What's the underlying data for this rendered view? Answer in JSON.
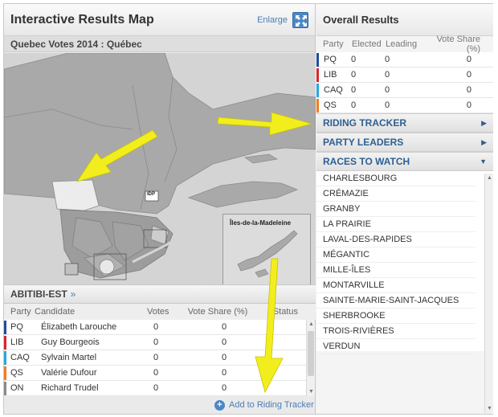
{
  "map_panel": {
    "title": "Interactive Results Map",
    "enlarge_label": "Enlarge",
    "subtitle": "Quebec Votes 2014 : Québec",
    "inset_label": "Îles-de-la-Madeleine",
    "map_badge": "IDP"
  },
  "riding": {
    "name": "ABITIBI-EST",
    "more": "»",
    "columns": [
      "Party",
      "Candidate",
      "Votes",
      "Vote Share (%)",
      "Status"
    ],
    "candidates": [
      {
        "party": "PQ",
        "name": "Élizabeth Larouche",
        "votes": "0",
        "share": "0",
        "color": "#1f4e9c"
      },
      {
        "party": "LIB",
        "name": "Guy Bourgeois",
        "votes": "0",
        "share": "0",
        "color": "#d8262d"
      },
      {
        "party": "CAQ",
        "name": "Sylvain Martel",
        "votes": "0",
        "share": "0",
        "color": "#27a8df"
      },
      {
        "party": "QS",
        "name": "Valérie Dufour",
        "votes": "0",
        "share": "0",
        "color": "#f07c21"
      },
      {
        "party": "ON",
        "name": "Richard Trudel",
        "votes": "0",
        "share": "0",
        "color": "#8a8a8a"
      }
    ],
    "add_label": "Add to Riding Tracker"
  },
  "overall": {
    "title": "Overall Results",
    "columns": [
      "Party",
      "Elected",
      "Leading",
      "Vote Share (%)"
    ],
    "rows": [
      {
        "party": "PQ",
        "elected": "0",
        "leading": "0",
        "share": "0",
        "color": "#1f4e9c"
      },
      {
        "party": "LIB",
        "elected": "0",
        "leading": "0",
        "share": "0",
        "color": "#d8262d"
      },
      {
        "party": "CAQ",
        "elected": "0",
        "leading": "0",
        "share": "0",
        "color": "#27a8df"
      },
      {
        "party": "QS",
        "elected": "0",
        "leading": "0",
        "share": "0",
        "color": "#f07c21"
      }
    ]
  },
  "accordion": {
    "riding_tracker": "RIDING TRACKER",
    "party_leaders": "PARTY LEADERS",
    "races_to_watch": "RACES TO WATCH"
  },
  "races": [
    "CHARLESBOURG",
    "CRÉMAZIE",
    "GRANBY",
    "LA PRAIRIE",
    "LAVAL-DES-RAPIDES",
    "MÉGANTIC",
    "MILLE-ÎLES",
    "MONTARVILLE",
    "SAINTE-MARIE-SAINT-JACQUES",
    "SHERBROOKE",
    "TROIS-RIVIÈRES",
    "VERDUN"
  ],
  "colors": {
    "accent": "#4a7db5",
    "annotation_arrow": "#f2ee1d"
  }
}
